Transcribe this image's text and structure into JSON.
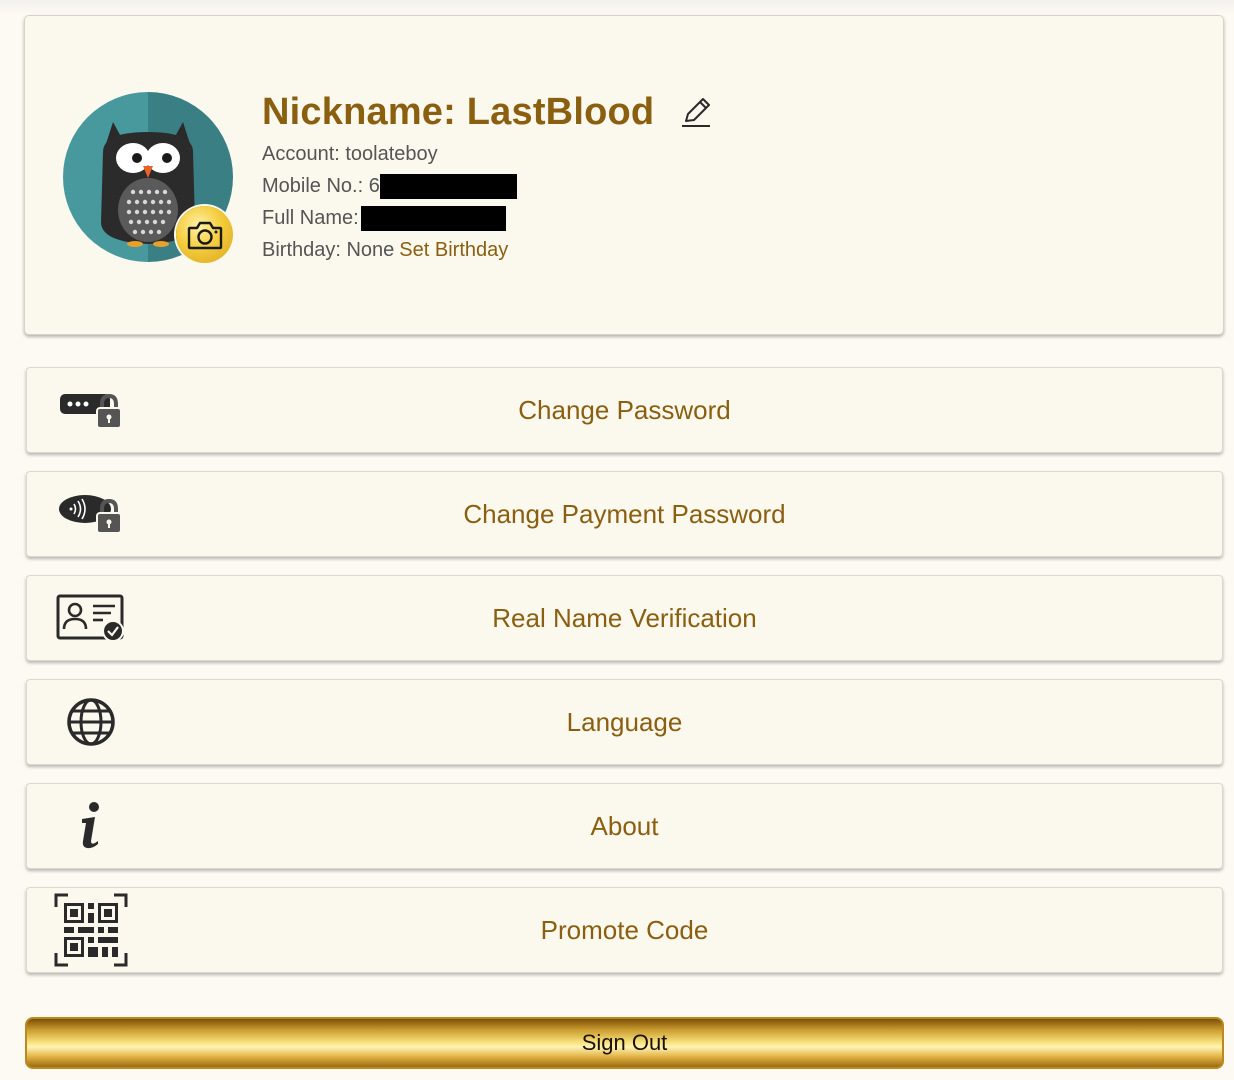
{
  "profile": {
    "nickname": "Nickname: LastBlood",
    "account": "Account: toolateboy",
    "mobile_label": "Mobile No.: 6",
    "fullname_label": "Full Name:",
    "birthday_label": "Birthday: None",
    "set_birthday": "Set Birthday"
  },
  "menu": [
    {
      "label": "Change Password",
      "icon": "password-lock-icon"
    },
    {
      "label": "Change Payment Password",
      "icon": "payment-lock-icon"
    },
    {
      "label": "Real Name Verification",
      "icon": "id-card-verified-icon"
    },
    {
      "label": "Language",
      "icon": "globe-icon"
    },
    {
      "label": "About",
      "icon": "info-icon"
    },
    {
      "label": "Promote Code",
      "icon": "qr-code-icon"
    }
  ],
  "signout": {
    "label": "Sign Out"
  },
  "colors": {
    "accent": "#8a5f10",
    "background": "#fcfaf3",
    "avatar_bg": "#3e8c93",
    "gold": "#f4cc3c"
  }
}
